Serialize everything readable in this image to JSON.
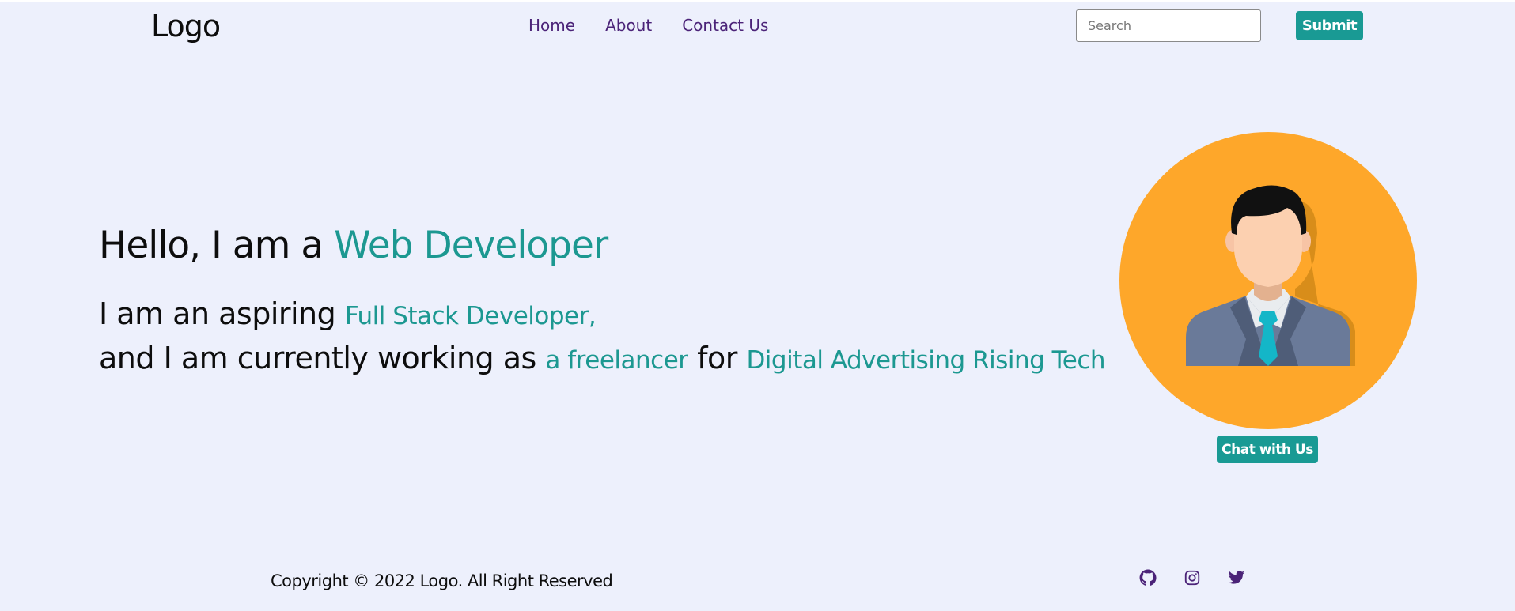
{
  "header": {
    "logo": "Logo",
    "nav": [
      "Home",
      "About",
      "Contact Us"
    ],
    "search_placeholder": "Search",
    "submit_label": "Submit"
  },
  "hero": {
    "title_prefix": "Hello, I am a ",
    "title_accent": "Web Developer",
    "line1_prefix": "I am an aspiring ",
    "line1_accent": "Full Stack Developer,",
    "line2_prefix": "and I am currently working as ",
    "line2_accent1": "a freelancer",
    "line2_mid": " for ",
    "line2_accent2": "Digital Advertising Rising Tech",
    "chat_label": "Chat with Us",
    "avatar_icon": "businessman-avatar-icon"
  },
  "footer": {
    "copyright": "Copyright © 2022 Logo. All Right Reserved",
    "social_icons": [
      "github-icon",
      "instagram-icon",
      "twitter-icon"
    ]
  },
  "colors": {
    "background": "#edf0fc",
    "accent": "#1c9891",
    "nav_link": "#4b2378",
    "avatar_bg": "#fea72a"
  }
}
